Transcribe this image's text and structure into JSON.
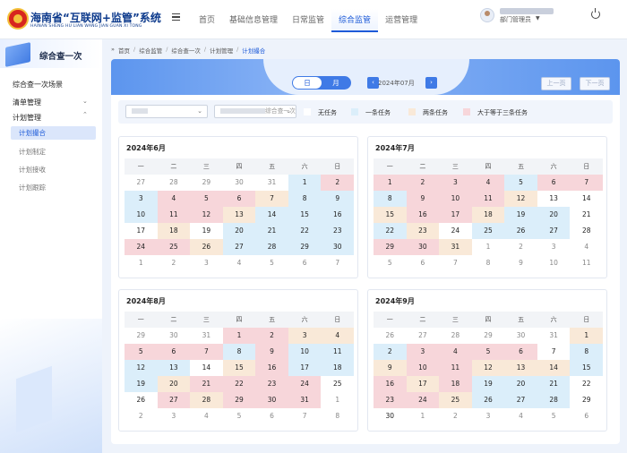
{
  "header": {
    "title": "海南省“互联网+监管”系统",
    "subtitle": "HAINAN SHENG HU LIAN WANG JIAN GUAN XI TONG",
    "tabs": [
      {
        "label": "首页"
      },
      {
        "label": "基础信息管理"
      },
      {
        "label": "日常监管"
      },
      {
        "label": "综合监管",
        "active": true
      },
      {
        "label": "运营管理"
      }
    ],
    "user_role": "部门管理员"
  },
  "sidebar": {
    "title": "综合查一次",
    "items": {
      "scene": "综合查一次场景",
      "list": "清单管理",
      "plan": "计划管理"
    },
    "sub": [
      {
        "label": "计划撮合",
        "active": true
      },
      {
        "label": "计划制定"
      },
      {
        "label": "计划接收"
      },
      {
        "label": "计划跟踪"
      }
    ]
  },
  "breadcrumb": [
    "首页",
    "综合监管",
    "综合查一次",
    "计划管理",
    "计划撮合"
  ],
  "view": {
    "day": "日",
    "month": "月",
    "current": "2024年07月",
    "prev_page": "上一页",
    "next_page": "下一页"
  },
  "filter": {
    "select2_suffix": "综合查一次"
  },
  "legend": [
    {
      "label": "无任务",
      "color": "#ffffff"
    },
    {
      "label": "一条任务",
      "color": "#dbeefa"
    },
    {
      "label": "两条任务",
      "color": "#f9e9d8"
    },
    {
      "label": "大于等于三条任务",
      "color": "#f7d6da"
    }
  ],
  "weekdays": [
    "一",
    "二",
    "三",
    "四",
    "五",
    "六",
    "日"
  ],
  "months": [
    {
      "title": "2024年6月",
      "days": [
        [
          "27",
          0,
          1
        ],
        [
          "28",
          0,
          1
        ],
        [
          "29",
          0,
          1
        ],
        [
          "30",
          0,
          1
        ],
        [
          "31",
          0,
          1
        ],
        [
          "1",
          1
        ],
        [
          "2",
          3
        ],
        [
          "3",
          1
        ],
        [
          "4",
          3
        ],
        [
          "5",
          3
        ],
        [
          "6",
          3
        ],
        [
          "7",
          2
        ],
        [
          "8",
          1
        ],
        [
          "9",
          1
        ],
        [
          "10",
          1
        ],
        [
          "11",
          3
        ],
        [
          "12",
          3
        ],
        [
          "13",
          2
        ],
        [
          "14",
          1
        ],
        [
          "15",
          1
        ],
        [
          "16",
          1
        ],
        [
          "17",
          0
        ],
        [
          "18",
          2
        ],
        [
          "19",
          0
        ],
        [
          "20",
          1
        ],
        [
          "21",
          1
        ],
        [
          "22",
          1
        ],
        [
          "23",
          1
        ],
        [
          "24",
          3
        ],
        [
          "25",
          3
        ],
        [
          "26",
          2
        ],
        [
          "27",
          1
        ],
        [
          "28",
          1
        ],
        [
          "29",
          1
        ],
        [
          "30",
          1
        ],
        [
          "1",
          0,
          1
        ],
        [
          "2",
          0,
          1
        ],
        [
          "3",
          0,
          1
        ],
        [
          "4",
          0,
          1
        ],
        [
          "5",
          0,
          1
        ],
        [
          "6",
          0,
          1
        ],
        [
          "7",
          0,
          1
        ]
      ]
    },
    {
      "title": "2024年7月",
      "days": [
        [
          "1",
          3
        ],
        [
          "2",
          3
        ],
        [
          "3",
          3
        ],
        [
          "4",
          3
        ],
        [
          "5",
          1
        ],
        [
          "6",
          3
        ],
        [
          "7",
          3
        ],
        [
          "8",
          1
        ],
        [
          "9",
          3
        ],
        [
          "10",
          3
        ],
        [
          "11",
          3
        ],
        [
          "12",
          2
        ],
        [
          "13",
          0
        ],
        [
          "14",
          0
        ],
        [
          "15",
          2
        ],
        [
          "16",
          3
        ],
        [
          "17",
          3
        ],
        [
          "18",
          2
        ],
        [
          "19",
          1
        ],
        [
          "20",
          1
        ],
        [
          "21",
          0
        ],
        [
          "22",
          1
        ],
        [
          "23",
          2
        ],
        [
          "24",
          0
        ],
        [
          "25",
          1
        ],
        [
          "26",
          1
        ],
        [
          "27",
          1
        ],
        [
          "28",
          0
        ],
        [
          "29",
          3
        ],
        [
          "30",
          3
        ],
        [
          "31",
          2
        ],
        [
          "1",
          0,
          1
        ],
        [
          "2",
          0,
          1
        ],
        [
          "3",
          0,
          1
        ],
        [
          "4",
          0,
          1
        ],
        [
          "5",
          0,
          1
        ],
        [
          "6",
          0,
          1
        ],
        [
          "7",
          0,
          1
        ],
        [
          "8",
          0,
          1
        ],
        [
          "9",
          0,
          1
        ],
        [
          "10",
          0,
          1
        ],
        [
          "11",
          0,
          1
        ]
      ]
    },
    {
      "title": "2024年8月",
      "days": [
        [
          "29",
          0,
          1
        ],
        [
          "30",
          0,
          1
        ],
        [
          "31",
          0,
          1
        ],
        [
          "1",
          3
        ],
        [
          "2",
          3
        ],
        [
          "3",
          2
        ],
        [
          "4",
          2
        ],
        [
          "5",
          3
        ],
        [
          "6",
          3
        ],
        [
          "7",
          3
        ],
        [
          "8",
          1
        ],
        [
          "9",
          3
        ],
        [
          "10",
          1
        ],
        [
          "11",
          1
        ],
        [
          "12",
          1
        ],
        [
          "13",
          1
        ],
        [
          "14",
          0
        ],
        [
          "15",
          2
        ],
        [
          "16",
          3
        ],
        [
          "17",
          1
        ],
        [
          "18",
          1
        ],
        [
          "19",
          1
        ],
        [
          "20",
          2
        ],
        [
          "21",
          3
        ],
        [
          "22",
          3
        ],
        [
          "23",
          3
        ],
        [
          "24",
          3
        ],
        [
          "25",
          0
        ],
        [
          "26",
          0
        ],
        [
          "27",
          3
        ],
        [
          "28",
          2
        ],
        [
          "29",
          3
        ],
        [
          "30",
          3
        ],
        [
          "31",
          3
        ],
        [
          "1",
          0,
          1
        ],
        [
          "2",
          0,
          1
        ],
        [
          "3",
          0,
          1
        ],
        [
          "4",
          0,
          1
        ],
        [
          "5",
          0,
          1
        ],
        [
          "6",
          0,
          1
        ],
        [
          "7",
          0,
          1
        ],
        [
          "8",
          0,
          1
        ]
      ]
    },
    {
      "title": "2024年9月",
      "days": [
        [
          "26",
          0,
          1
        ],
        [
          "27",
          0,
          1
        ],
        [
          "28",
          0,
          1
        ],
        [
          "29",
          0,
          1
        ],
        [
          "30",
          0,
          1
        ],
        [
          "31",
          0,
          1
        ],
        [
          "1",
          2
        ],
        [
          "2",
          1
        ],
        [
          "3",
          3
        ],
        [
          "4",
          3
        ],
        [
          "5",
          3
        ],
        [
          "6",
          3
        ],
        [
          "7",
          0
        ],
        [
          "8",
          1
        ],
        [
          "9",
          2
        ],
        [
          "10",
          3
        ],
        [
          "11",
          3
        ],
        [
          "12",
          2
        ],
        [
          "13",
          2
        ],
        [
          "14",
          2
        ],
        [
          "15",
          1
        ],
        [
          "16",
          3
        ],
        [
          "17",
          2
        ],
        [
          "18",
          3
        ],
        [
          "19",
          1
        ],
        [
          "20",
          1
        ],
        [
          "21",
          1
        ],
        [
          "22",
          0
        ],
        [
          "23",
          3
        ],
        [
          "24",
          3
        ],
        [
          "25",
          2
        ],
        [
          "26",
          1
        ],
        [
          "27",
          1
        ],
        [
          "28",
          1
        ],
        [
          "29",
          0
        ],
        [
          "30",
          0
        ],
        [
          "1",
          0,
          1
        ],
        [
          "2",
          0,
          1
        ],
        [
          "3",
          0,
          1
        ],
        [
          "4",
          0,
          1
        ],
        [
          "5",
          0,
          1
        ],
        [
          "6",
          0,
          1
        ]
      ]
    }
  ]
}
